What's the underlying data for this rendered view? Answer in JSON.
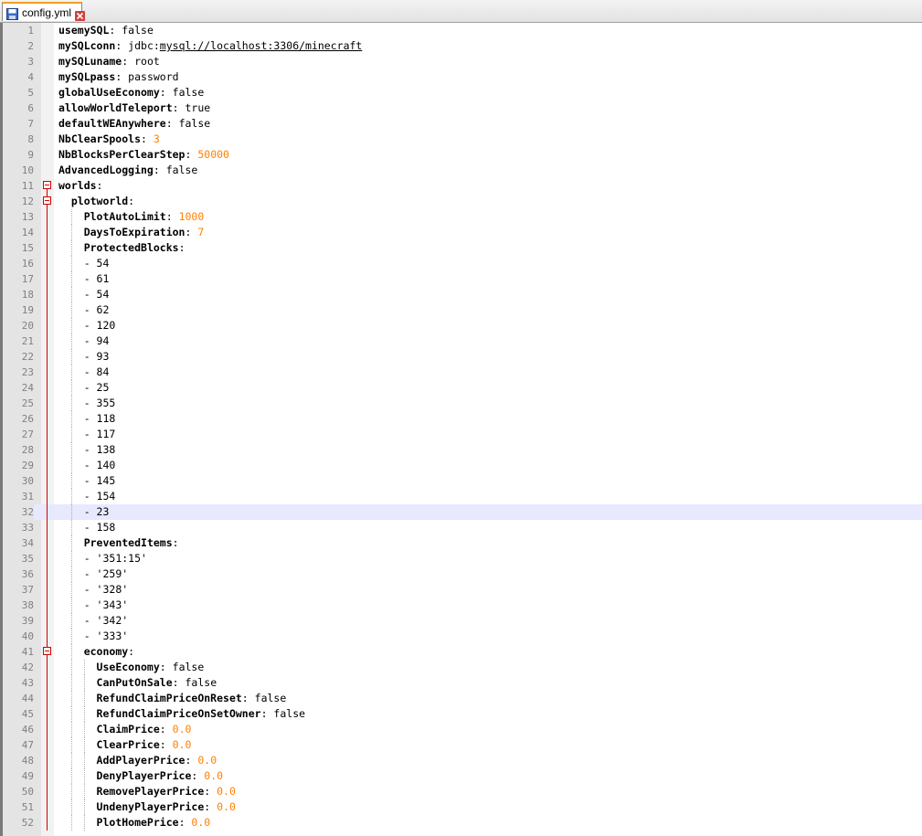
{
  "tab": {
    "label": "config.yml",
    "icon": "save-disk-icon",
    "close_icon": "close-icon"
  },
  "current_line": 32,
  "lines": [
    {
      "n": "1",
      "indent": 0,
      "key": "usemySQL",
      "sep": ": ",
      "val": "false",
      "type": "val"
    },
    {
      "n": "2",
      "indent": 0,
      "key": "mySQLconn",
      "sep": ": ",
      "val_pre": "jdbc:",
      "val": "mysql://localhost:3306/minecraft",
      "type": "url"
    },
    {
      "n": "3",
      "indent": 0,
      "key": "mySQLuname",
      "sep": ": ",
      "val": "root",
      "type": "val"
    },
    {
      "n": "4",
      "indent": 0,
      "key": "mySQLpass",
      "sep": ": ",
      "val": "password",
      "type": "val"
    },
    {
      "n": "5",
      "indent": 0,
      "key": "globalUseEconomy",
      "sep": ": ",
      "val": "false",
      "type": "val"
    },
    {
      "n": "6",
      "indent": 0,
      "key": "allowWorldTeleport",
      "sep": ": ",
      "val": "true",
      "type": "val"
    },
    {
      "n": "7",
      "indent": 0,
      "key": "defaultWEAnywhere",
      "sep": ": ",
      "val": "false",
      "type": "val"
    },
    {
      "n": "8",
      "indent": 0,
      "key": "NbClearSpools",
      "sep": ": ",
      "val": "3",
      "type": "num"
    },
    {
      "n": "9",
      "indent": 0,
      "key": "NbBlocksPerClearStep",
      "sep": ": ",
      "val": "50000",
      "type": "num"
    },
    {
      "n": "10",
      "indent": 0,
      "key": "AdvancedLogging",
      "sep": ": ",
      "val": "false",
      "type": "val"
    },
    {
      "n": "11",
      "indent": 0,
      "key": "worlds",
      "sep": ":",
      "val": "",
      "type": "val",
      "fold": "open"
    },
    {
      "n": "12",
      "indent": 2,
      "key": "plotworld",
      "sep": ":",
      "val": "",
      "type": "val",
      "fold": "open"
    },
    {
      "n": "13",
      "indent": 4,
      "key": "PlotAutoLimit",
      "sep": ": ",
      "val": "1000",
      "type": "num"
    },
    {
      "n": "14",
      "indent": 4,
      "key": "DaysToExpiration",
      "sep": ": ",
      "val": "7",
      "type": "num"
    },
    {
      "n": "15",
      "indent": 4,
      "key": "ProtectedBlocks",
      "sep": ":",
      "val": "",
      "type": "val"
    },
    {
      "n": "16",
      "indent": 4,
      "key": "",
      "sep": "",
      "val": "- 54",
      "type": "val"
    },
    {
      "n": "17",
      "indent": 4,
      "key": "",
      "sep": "",
      "val": "- 61",
      "type": "val"
    },
    {
      "n": "18",
      "indent": 4,
      "key": "",
      "sep": "",
      "val": "- 54",
      "type": "val"
    },
    {
      "n": "19",
      "indent": 4,
      "key": "",
      "sep": "",
      "val": "- 62",
      "type": "val"
    },
    {
      "n": "20",
      "indent": 4,
      "key": "",
      "sep": "",
      "val": "- 120",
      "type": "val"
    },
    {
      "n": "21",
      "indent": 4,
      "key": "",
      "sep": "",
      "val": "- 94",
      "type": "val"
    },
    {
      "n": "22",
      "indent": 4,
      "key": "",
      "sep": "",
      "val": "- 93",
      "type": "val"
    },
    {
      "n": "23",
      "indent": 4,
      "key": "",
      "sep": "",
      "val": "- 84",
      "type": "val"
    },
    {
      "n": "24",
      "indent": 4,
      "key": "",
      "sep": "",
      "val": "- 25",
      "type": "val"
    },
    {
      "n": "25",
      "indent": 4,
      "key": "",
      "sep": "",
      "val": "- 355",
      "type": "val"
    },
    {
      "n": "26",
      "indent": 4,
      "key": "",
      "sep": "",
      "val": "- 118",
      "type": "val"
    },
    {
      "n": "27",
      "indent": 4,
      "key": "",
      "sep": "",
      "val": "- 117",
      "type": "val"
    },
    {
      "n": "28",
      "indent": 4,
      "key": "",
      "sep": "",
      "val": "- 138",
      "type": "val"
    },
    {
      "n": "29",
      "indent": 4,
      "key": "",
      "sep": "",
      "val": "- 140",
      "type": "val"
    },
    {
      "n": "30",
      "indent": 4,
      "key": "",
      "sep": "",
      "val": "- 145",
      "type": "val"
    },
    {
      "n": "31",
      "indent": 4,
      "key": "",
      "sep": "",
      "val": "- 154",
      "type": "val"
    },
    {
      "n": "32",
      "indent": 4,
      "key": "",
      "sep": "",
      "val": "- 23",
      "type": "val"
    },
    {
      "n": "33",
      "indent": 4,
      "key": "",
      "sep": "",
      "val": "- 158",
      "type": "val"
    },
    {
      "n": "34",
      "indent": 4,
      "key": "PreventedItems",
      "sep": ":",
      "val": "",
      "type": "val"
    },
    {
      "n": "35",
      "indent": 4,
      "key": "",
      "sep": "",
      "val": "- '351:15'",
      "type": "val"
    },
    {
      "n": "36",
      "indent": 4,
      "key": "",
      "sep": "",
      "val": "- '259'",
      "type": "val"
    },
    {
      "n": "37",
      "indent": 4,
      "key": "",
      "sep": "",
      "val": "- '328'",
      "type": "val"
    },
    {
      "n": "38",
      "indent": 4,
      "key": "",
      "sep": "",
      "val": "- '343'",
      "type": "val"
    },
    {
      "n": "39",
      "indent": 4,
      "key": "",
      "sep": "",
      "val": "- '342'",
      "type": "val"
    },
    {
      "n": "40",
      "indent": 4,
      "key": "",
      "sep": "",
      "val": "- '333'",
      "type": "val"
    },
    {
      "n": "41",
      "indent": 4,
      "key": "economy",
      "sep": ":",
      "val": "",
      "type": "val",
      "fold": "open"
    },
    {
      "n": "42",
      "indent": 6,
      "key": "UseEconomy",
      "sep": ": ",
      "val": "false",
      "type": "val"
    },
    {
      "n": "43",
      "indent": 6,
      "key": "CanPutOnSale",
      "sep": ": ",
      "val": "false",
      "type": "val"
    },
    {
      "n": "44",
      "indent": 6,
      "key": "RefundClaimPriceOnReset",
      "sep": ": ",
      "val": "false",
      "type": "val"
    },
    {
      "n": "45",
      "indent": 6,
      "key": "RefundClaimPriceOnSetOwner",
      "sep": ": ",
      "val": "false",
      "type": "val"
    },
    {
      "n": "46",
      "indent": 6,
      "key": "ClaimPrice",
      "sep": ": ",
      "val": "0.0",
      "type": "num"
    },
    {
      "n": "47",
      "indent": 6,
      "key": "ClearPrice",
      "sep": ": ",
      "val": "0.0",
      "type": "num"
    },
    {
      "n": "48",
      "indent": 6,
      "key": "AddPlayerPrice",
      "sep": ": ",
      "val": "0.0",
      "type": "num"
    },
    {
      "n": "49",
      "indent": 6,
      "key": "DenyPlayerPrice",
      "sep": ": ",
      "val": "0.0",
      "type": "num"
    },
    {
      "n": "50",
      "indent": 6,
      "key": "RemovePlayerPrice",
      "sep": ": ",
      "val": "0.0",
      "type": "num"
    },
    {
      "n": "51",
      "indent": 6,
      "key": "UndenyPlayerPrice",
      "sep": ": ",
      "val": "0.0",
      "type": "num"
    },
    {
      "n": "52",
      "indent": 6,
      "key": "PlotHomePrice",
      "sep": ": ",
      "val": "0.0",
      "type": "num"
    }
  ]
}
